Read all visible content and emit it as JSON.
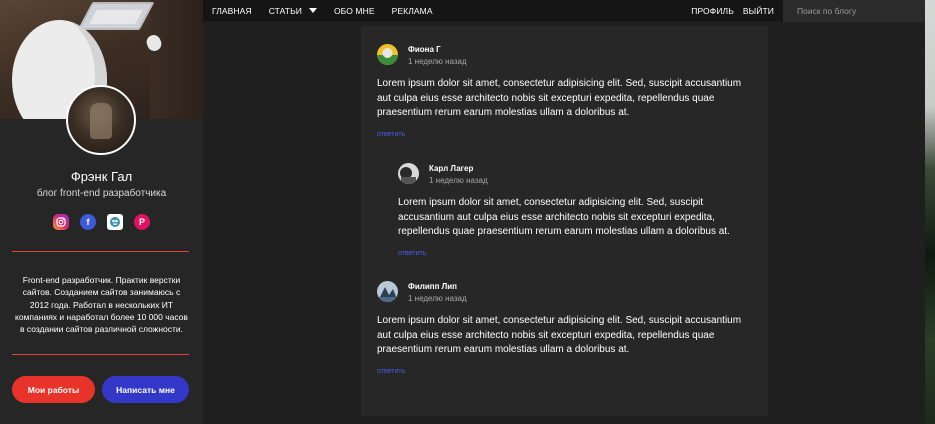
{
  "nav": {
    "items": [
      {
        "label": "ГЛАВНАЯ"
      },
      {
        "label": "СТАТЬИ"
      },
      {
        "label": "ОБО МНЕ"
      },
      {
        "label": "РЕКЛАМА"
      }
    ],
    "profile_label": "ПРОФИЛЬ",
    "logout_label": "ВЫЙТИ",
    "search_placeholder": "Поиск по блогу"
  },
  "sidebar": {
    "name": "Фрэнк Гал",
    "subtitle": "блог front-end разработчика",
    "socials": [
      {
        "icon": "instagram-icon"
      },
      {
        "icon": "facebook-icon"
      },
      {
        "icon": "vk-icon"
      },
      {
        "icon": "pinterest-icon"
      }
    ],
    "about": "Front-end разработчик. Практик верстки сайтов. Созданием сайтов занимаюсь с 2012 года. Работал в нескольких ИТ компаниях и наработал более 10 000 часов в создании сайтов различной сложности.",
    "btn_works": "Мои работы",
    "btn_write": "Написать мне"
  },
  "comments": [
    {
      "author": "Фиона Г",
      "time": "1 неделю назад",
      "text": "Lorem ipsum dolor sit amet, consectetur adipisicing elit. Sed, suscipit accusantium aut culpa eius esse architecto nobis sit excepturi expedita, repellendus quae praesentium rerum earum molestias ullam a doloribus at.",
      "reply": "ответить"
    },
    {
      "author": "Карл Лагер",
      "time": "1 неделю назад",
      "text": "Lorem ipsum dolor sit amet, consectetur adipisicing elit. Sed, suscipit accusantium aut culpa eius esse architecto nobis sit excepturi expedita, repellendus quae praesentium rerum earum molestias ullam a doloribus at.",
      "reply": "ответить"
    },
    {
      "author": "Филипп Лип",
      "time": "1 неделю назад",
      "text": "Lorem ipsum dolor sit amet, consectetur adipisicing elit. Sed, suscipit accusantium aut culpa eius esse architecto nobis sit excepturi expedita, repellendus quae praesentium rerum earum molestias ullam a doloribus at.",
      "reply": "ответить"
    }
  ],
  "colors": {
    "accent_red": "#e8332a",
    "accent_blue": "#3438c8",
    "link_blue": "#4a5be8"
  }
}
